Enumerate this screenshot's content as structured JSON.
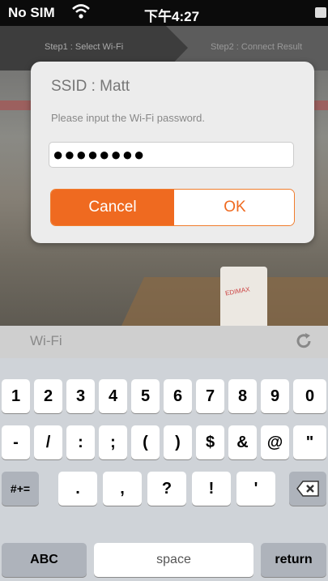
{
  "status_bar": {
    "carrier": "No SIM",
    "time": "下午4:27"
  },
  "steps": {
    "step1": "Step1 : Select Wi-Fi",
    "step2": "Step2 : Connect Result"
  },
  "background": {
    "cup_text": "EDIMAX"
  },
  "dialog": {
    "ssid": "SSID : Matt",
    "prompt": "Please input the Wi-Fi password.",
    "password_masked": "●●●●●●●●",
    "cancel_label": "Cancel",
    "ok_label": "OK"
  },
  "wifi_bar": {
    "label": "Wi-Fi"
  },
  "keyboard": {
    "row1": [
      "1",
      "2",
      "3",
      "4",
      "5",
      "6",
      "7",
      "8",
      "9",
      "0"
    ],
    "row2": [
      "-",
      "/",
      ":",
      ";",
      "(",
      ")",
      "$",
      "&",
      "@",
      "\""
    ],
    "row3": [
      ".",
      ",",
      "?",
      "!",
      "'"
    ],
    "mode_key": "#+=",
    "abc_key": "ABC",
    "space_key": "space",
    "return_key": "return"
  },
  "colors": {
    "accent": "#ef6a20",
    "dialog_bg": "#ececec",
    "keyboard_bg": "#cfd3d8"
  }
}
